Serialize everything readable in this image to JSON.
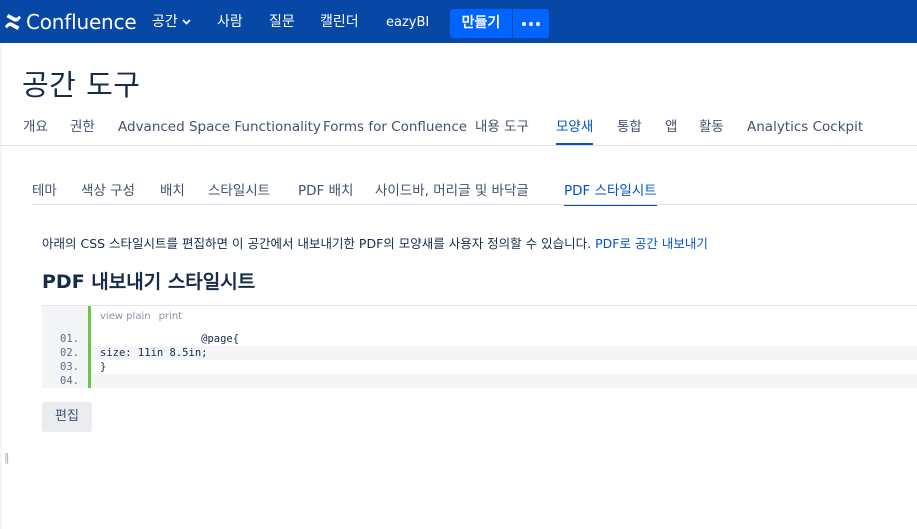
{
  "topnav": {
    "brand": "Confluence",
    "items": [
      {
        "label": "공간",
        "has_caret": true
      },
      {
        "label": "사람"
      },
      {
        "label": "질문"
      },
      {
        "label": "캘린더"
      },
      {
        "label": "eazyBI"
      }
    ],
    "create_label": "만들기",
    "more_icon": "ellipsis-icon",
    "colors": {
      "bar": "#0747a6",
      "button": "#0065ff"
    }
  },
  "page": {
    "title": "공간 도구"
  },
  "primary_tabs": [
    {
      "label": "개요"
    },
    {
      "label": "권한"
    },
    {
      "label": "Advanced Space Functionality"
    },
    {
      "label": "Forms for Confluence"
    },
    {
      "label": "내용 도구"
    },
    {
      "label": "모양새",
      "active": true
    },
    {
      "label": "통합"
    },
    {
      "label": "앱"
    },
    {
      "label": "활동"
    },
    {
      "label": "Analytics Cockpit"
    }
  ],
  "secondary_tabs": [
    {
      "label": "테마"
    },
    {
      "label": "색상 구성"
    },
    {
      "label": "배치"
    },
    {
      "label": "스타일시트"
    },
    {
      "label": "PDF 배치"
    },
    {
      "label": "사이드바, 머리글 및 바닥글"
    },
    {
      "label": "PDF 스타일시트",
      "active": true
    }
  ],
  "content": {
    "description": "아래의 CSS 스타일시트를 편집하면 이 공간에서 내보내기한 PDF의 모양새를 사용자 정의할 수 있습니다. ",
    "description_link": "PDF로 공간 내보내기",
    "section_title": "PDF 내보내기 스타일시트",
    "code_toolbar": [
      "view plain",
      "print"
    ],
    "code_lines": [
      {
        "num": "01.",
        "text": "                @page{"
      },
      {
        "num": "02.",
        "text": "size: 11in 8.5in;"
      },
      {
        "num": "03.",
        "text": "}"
      },
      {
        "num": "04.",
        "text": ""
      }
    ],
    "edit_label": "편집",
    "accent_color": "#6cc644"
  }
}
